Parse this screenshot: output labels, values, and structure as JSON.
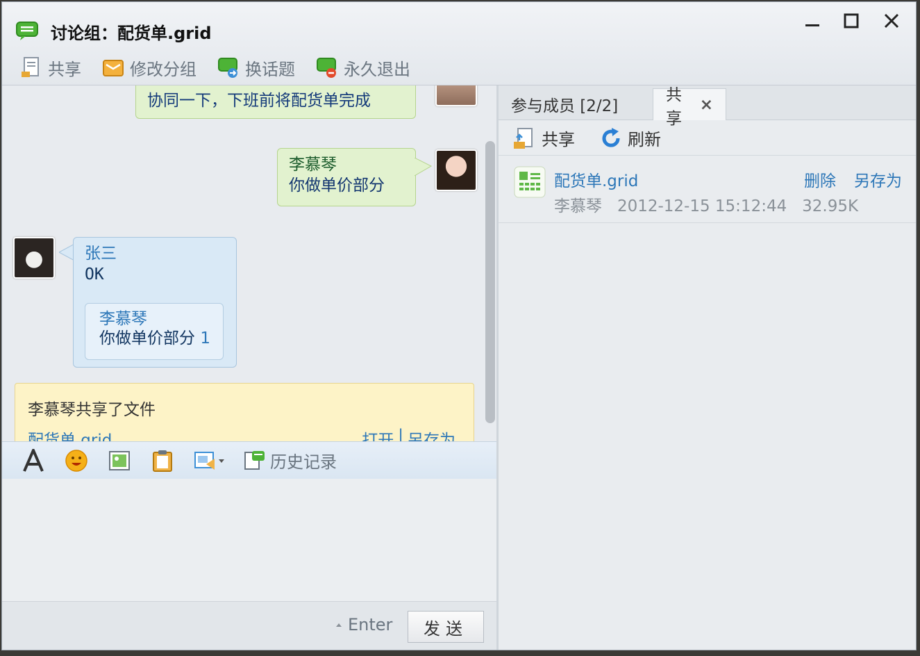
{
  "window": {
    "title": "讨论组：配货单.grid",
    "controls": {
      "minimize": "—",
      "maximize": "☐",
      "close": "✕"
    }
  },
  "toolbar": {
    "items": [
      {
        "label": "共享",
        "icon": "share-file-icon"
      },
      {
        "label": "修改分组",
        "icon": "edit-group-icon"
      },
      {
        "label": "换话题",
        "icon": "change-topic-icon"
      },
      {
        "label": "永久退出",
        "icon": "exit-icon"
      }
    ]
  },
  "chat": {
    "messages": [
      {
        "text": "协同一下，下班前将配货单完成"
      },
      {
        "sender": "李慕琴",
        "text": "你做单价部分"
      },
      {
        "sender": "张三",
        "text": "OK",
        "quote": {
          "sender": "李慕琴",
          "text": "你做单价部分",
          "mark": "1"
        }
      }
    ],
    "notice": {
      "text": "李慕琴共享了文件",
      "file": "配货单.grid",
      "open": "打开",
      "separator": "|",
      "save_as": "另存为"
    }
  },
  "inputbar": {
    "history": "历史记录"
  },
  "send": {
    "enter_label": "Enter",
    "send_label": "发送"
  },
  "right_panel": {
    "tabs": [
      {
        "label": "参与成员 [2/2]"
      },
      {
        "label": "共享",
        "close": "×"
      }
    ],
    "tools": [
      {
        "label": "共享"
      },
      {
        "label": "刷新"
      }
    ],
    "file": {
      "name": "配货单.grid",
      "owner": "李慕琴",
      "datetime": "2012-12-15 15:12:44",
      "size": "32.95K",
      "delete": "删除",
      "save_as": "另存为"
    }
  },
  "colors": {
    "accent_blue": "#2d77b8",
    "bubble_green": "#e2f2cf",
    "bubble_blue": "#d9e9f6",
    "notice_yellow": "#fdf3c7"
  }
}
